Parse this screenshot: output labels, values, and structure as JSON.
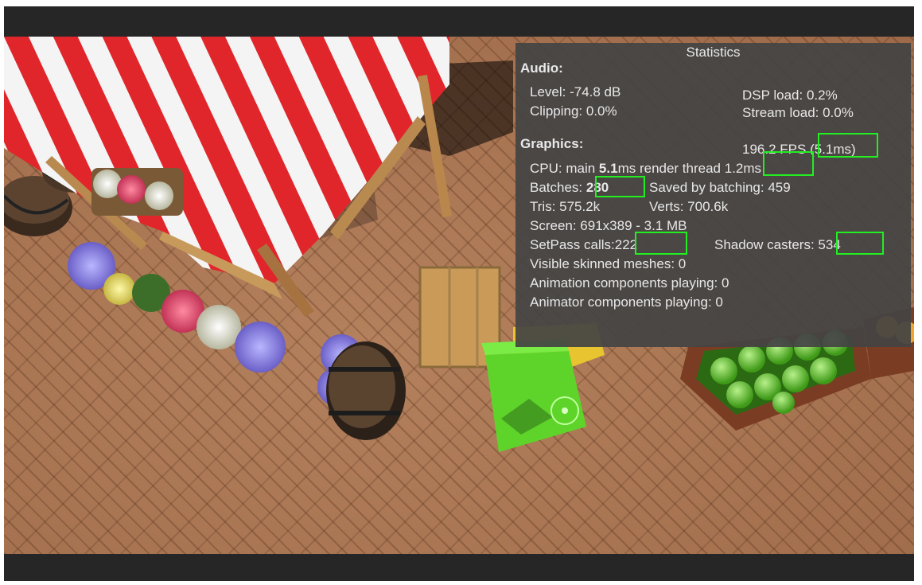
{
  "window": {
    "title": "Statistics"
  },
  "audio": {
    "heading": "Audio:",
    "level": "Level: -74.8 dB",
    "clipping": "Clipping: 0.0%",
    "dsp_load": "DSP load: 0.2%",
    "stream_load": "Stream load: 0.0%"
  },
  "graphics": {
    "heading": "Graphics:",
    "fps": "196.2 FPS",
    "frame_ms": "(5.1ms)",
    "cpu_prefix": "CPU: main ",
    "cpu_main": "5.1",
    "cpu_suffix": "ms  render thread",
    "render_thread": "1.2ms",
    "batches_label": "Batches:",
    "batches": "280",
    "saved_by_batching": "Saved by batching: 459",
    "tris": "Tris: 575.2k",
    "verts": "Verts: 700.6k",
    "screen": "Screen: 691x389 - 3.1 MB",
    "setpass_label": "SetPass calls:",
    "setpass": "222",
    "shadow_label": "Shadow casters:",
    "shadow": "534",
    "visible_skinned": "Visible skinned meshes: 0",
    "animation_components": "Animation components playing: 0",
    "animator_components": "Animator components playing: 0"
  },
  "colors": {
    "highlight": "#22ee22",
    "panel_bg": "#444444",
    "ground": "#a4704f",
    "awning_red": "#e0262b",
    "awning_white": "#f4f4f4",
    "cube_green": "#5ed42a"
  }
}
